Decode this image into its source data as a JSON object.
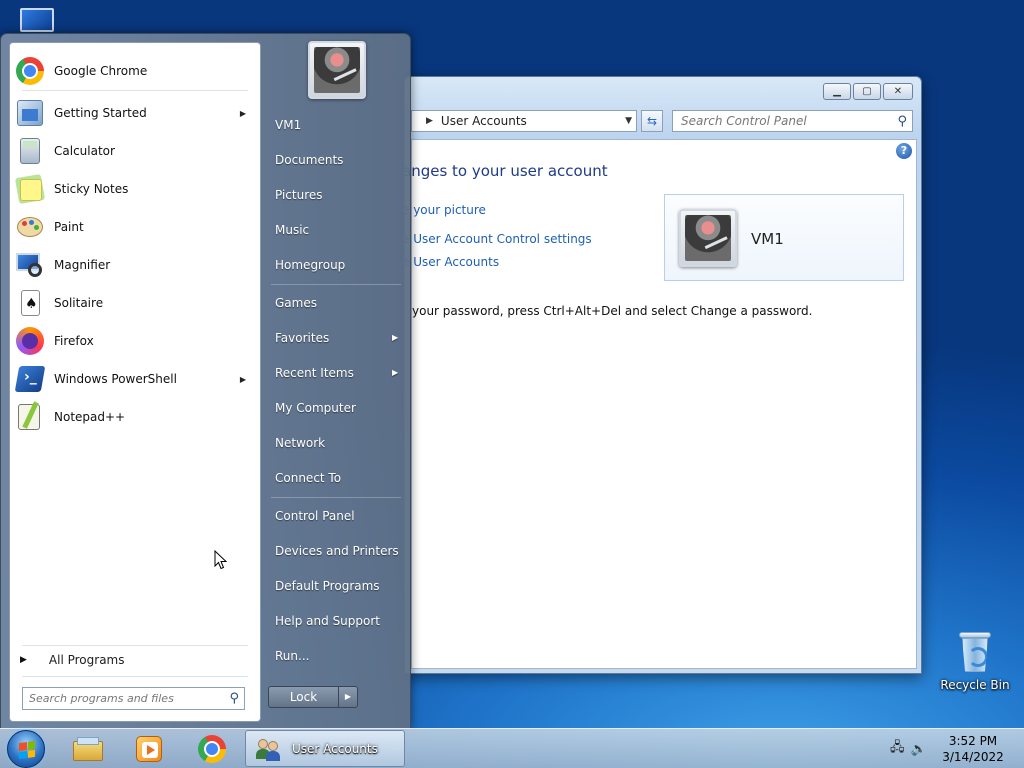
{
  "desktop": {
    "recycle_bin_label": "Recycle Bin"
  },
  "control_panel": {
    "address_crumb": "User Accounts",
    "search_placeholder": "Search Control Panel",
    "heading": "anges to your user account",
    "links": [
      "e your picture",
      "e User Account Control settings",
      "e User Accounts"
    ],
    "password_text": "your password, press Ctrl+Alt+Del and select Change a password.",
    "user_name": "VM1",
    "help_glyph": "?"
  },
  "start_menu": {
    "programs": [
      {
        "label": "Google Chrome",
        "icon": "chrome-icon",
        "has_submenu": false
      },
      {
        "label": "Getting Started",
        "icon": "getting-started-icon",
        "has_submenu": true
      },
      {
        "label": "Calculator",
        "icon": "calculator-icon",
        "has_submenu": false
      },
      {
        "label": "Sticky Notes",
        "icon": "sticky-notes-icon",
        "has_submenu": false
      },
      {
        "label": "Paint",
        "icon": "paint-icon",
        "has_submenu": false
      },
      {
        "label": "Magnifier",
        "icon": "magnifier-icon",
        "has_submenu": false
      },
      {
        "label": "Solitaire",
        "icon": "solitaire-icon",
        "has_submenu": false
      },
      {
        "label": "Firefox",
        "icon": "firefox-icon",
        "has_submenu": false
      },
      {
        "label": "Windows PowerShell",
        "icon": "powershell-icon",
        "has_submenu": true
      },
      {
        "label": "Notepad++",
        "icon": "notepadpp-icon",
        "has_submenu": false
      }
    ],
    "all_programs": "All Programs",
    "search_placeholder": "Search programs and files",
    "right_items": [
      {
        "label": "VM1",
        "has_submenu": false
      },
      {
        "label": "Documents",
        "has_submenu": false
      },
      {
        "label": "Pictures",
        "has_submenu": false
      },
      {
        "label": "Music",
        "has_submenu": false
      },
      {
        "label": "Homegroup",
        "has_submenu": false
      },
      {
        "label": "Games",
        "has_submenu": false
      },
      {
        "label": "Favorites",
        "has_submenu": true
      },
      {
        "label": "Recent Items",
        "has_submenu": true
      },
      {
        "label": "My Computer",
        "has_submenu": false
      },
      {
        "label": "Network",
        "has_submenu": false
      },
      {
        "label": "Connect To",
        "has_submenu": false
      },
      {
        "label": "Control Panel",
        "has_submenu": false
      },
      {
        "label": "Devices and Printers",
        "has_submenu": false
      },
      {
        "label": "Default Programs",
        "has_submenu": false
      },
      {
        "label": "Help and Support",
        "has_submenu": false
      },
      {
        "label": "Run...",
        "has_submenu": false
      }
    ],
    "lock_label": "Lock"
  },
  "taskbar": {
    "pinned": [
      "explorer-icon",
      "media-player-icon",
      "chrome-icon"
    ],
    "active_task": "User Accounts",
    "time": "3:52 PM",
    "date": "3/14/2022"
  }
}
